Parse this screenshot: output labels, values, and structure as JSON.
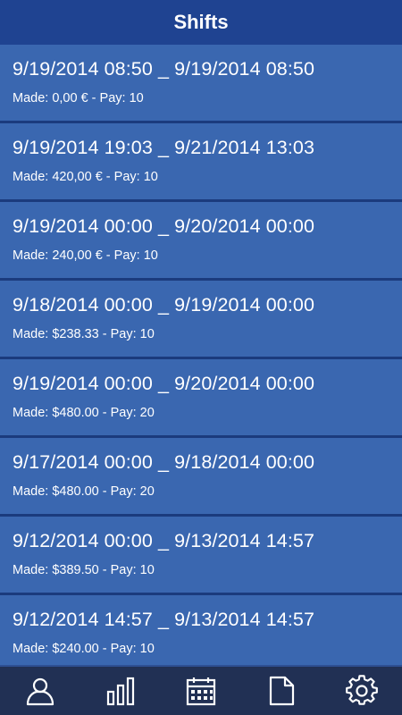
{
  "header": {
    "title": "Shifts"
  },
  "shifts": [
    {
      "range": "9/19/2014 08:50 _ 9/19/2014 08:50",
      "summary": "Made: 0,00 € - Pay: 10"
    },
    {
      "range": "9/19/2014 19:03 _ 9/21/2014 13:03",
      "summary": "Made: 420,00 € - Pay: 10"
    },
    {
      "range": "9/19/2014 00:00 _ 9/20/2014 00:00",
      "summary": "Made: 240,00 € - Pay: 10"
    },
    {
      "range": "9/18/2014 00:00 _ 9/19/2014 00:00",
      "summary": "Made: $238.33 - Pay: 10"
    },
    {
      "range": "9/19/2014 00:00 _ 9/20/2014 00:00",
      "summary": "Made: $480.00 - Pay: 20"
    },
    {
      "range": "9/17/2014 00:00 _ 9/18/2014 00:00",
      "summary": "Made: $480.00 - Pay: 20"
    },
    {
      "range": "9/12/2014 00:00 _ 9/13/2014 14:57",
      "summary": "Made: $389.50 - Pay: 10"
    },
    {
      "range": "9/12/2014 14:57 _ 9/13/2014 14:57",
      "summary": "Made: $240.00 - Pay: 10"
    }
  ],
  "tabbar": {
    "icons": [
      "user-icon",
      "bar-chart-icon",
      "calendar-icon",
      "document-icon",
      "gear-icon"
    ]
  },
  "colors": {
    "header_bg": "#1f4391",
    "row_bg": "#3a67b0",
    "tabbar_bg": "#213054",
    "text": "#ffffff"
  }
}
